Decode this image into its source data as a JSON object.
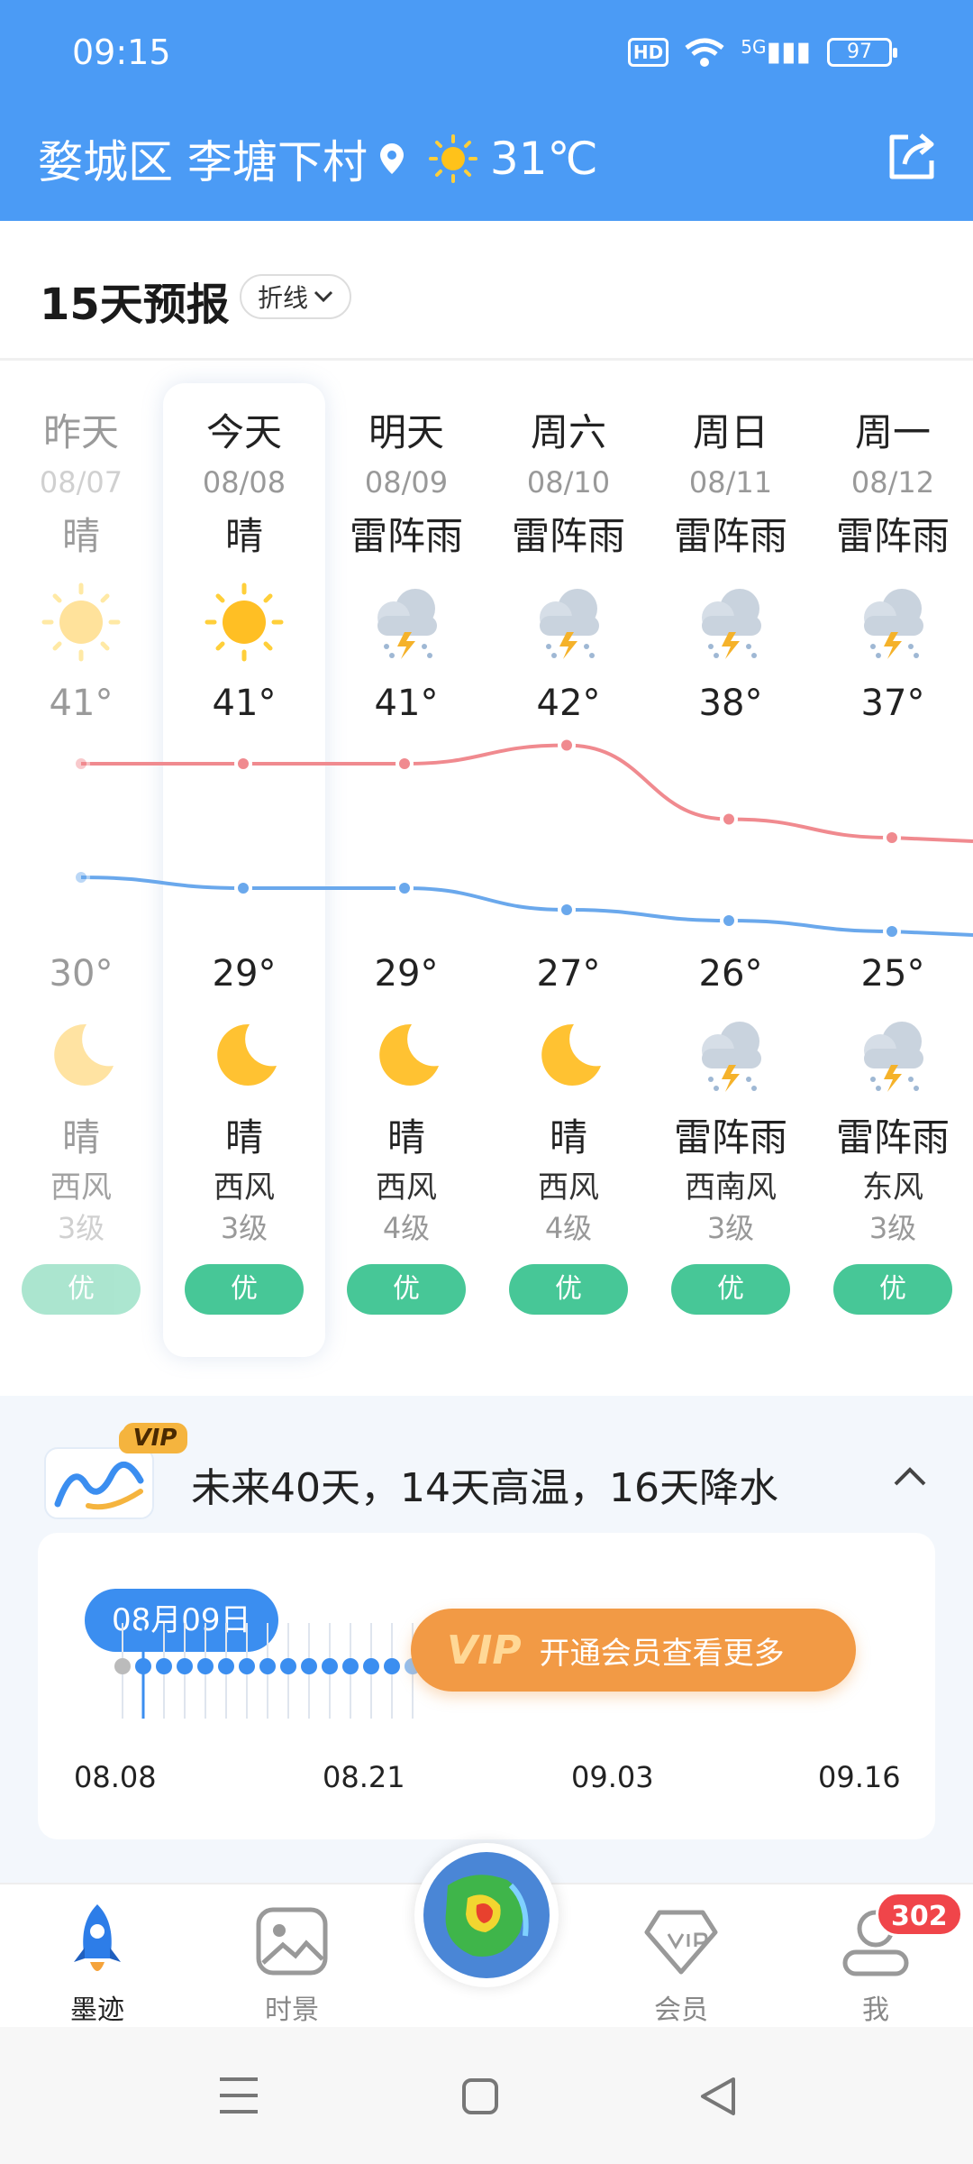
{
  "status_bar": {
    "time": "09:15",
    "hd": "HD",
    "network": "5G",
    "battery": "97"
  },
  "header": {
    "location": "婺城区 李塘下村",
    "temperature": "31℃"
  },
  "forecast": {
    "title": "15天预报",
    "mode": "折线",
    "days": [
      {
        "name": "昨天",
        "date": "08/07",
        "day_cond": "晴",
        "high": "41°",
        "low": "30°",
        "night_cond": "晴",
        "wind": "西风",
        "wind_level": "3级",
        "aqi": "优",
        "day_icon": "sun-icon",
        "night_icon": "moon-icon",
        "past": true
      },
      {
        "name": "今天",
        "date": "08/08",
        "day_cond": "晴",
        "high": "41°",
        "low": "29°",
        "night_cond": "晴",
        "wind": "西风",
        "wind_level": "3级",
        "aqi": "优",
        "day_icon": "sun-icon",
        "night_icon": "moon-icon",
        "past": false
      },
      {
        "name": "明天",
        "date": "08/09",
        "day_cond": "雷阵雨",
        "high": "41°",
        "low": "29°",
        "night_cond": "晴",
        "wind": "西风",
        "wind_level": "4级",
        "aqi": "优",
        "day_icon": "thunderstorm-icon",
        "night_icon": "moon-icon",
        "past": false
      },
      {
        "name": "周六",
        "date": "08/10",
        "day_cond": "雷阵雨",
        "high": "42°",
        "low": "27°",
        "night_cond": "晴",
        "wind": "西风",
        "wind_level": "4级",
        "aqi": "优",
        "day_icon": "thunderstorm-icon",
        "night_icon": "moon-icon",
        "past": false
      },
      {
        "name": "周日",
        "date": "08/11",
        "day_cond": "雷阵雨",
        "high": "38°",
        "low": "26°",
        "night_cond": "雷阵雨",
        "wind": "西南风",
        "wind_level": "3级",
        "aqi": "优",
        "day_icon": "thunderstorm-icon",
        "night_icon": "thunderstorm-icon",
        "past": false
      },
      {
        "name": "周一",
        "date": "08/12",
        "day_cond": "雷阵雨",
        "high": "37°",
        "low": "25°",
        "night_cond": "雷阵雨",
        "wind": "东风",
        "wind_level": "3级",
        "aqi": "优",
        "day_icon": "thunderstorm-icon",
        "night_icon": "thunderstorm-icon",
        "past": false
      }
    ],
    "colors": {
      "high_line": "#f08a8f",
      "low_line": "#6aa8ec",
      "aqi_good": "#47c797"
    }
  },
  "vip": {
    "badge": "VIP",
    "summary": "未来40天，14天高温，16天降水",
    "selected_date": "08月09日",
    "button_label": "开通会员查看更多",
    "timeline_labels": [
      "08.08",
      "08.21",
      "09.03",
      "09.16"
    ]
  },
  "nav": {
    "items": [
      {
        "label": "墨迹",
        "icon": "rocket-icon"
      },
      {
        "label": "时景",
        "icon": "photo-icon"
      },
      {
        "label": "会员",
        "icon": "vip-diamond-icon"
      },
      {
        "label": "我",
        "icon": "profile-icon"
      }
    ],
    "badge_count": "302"
  }
}
